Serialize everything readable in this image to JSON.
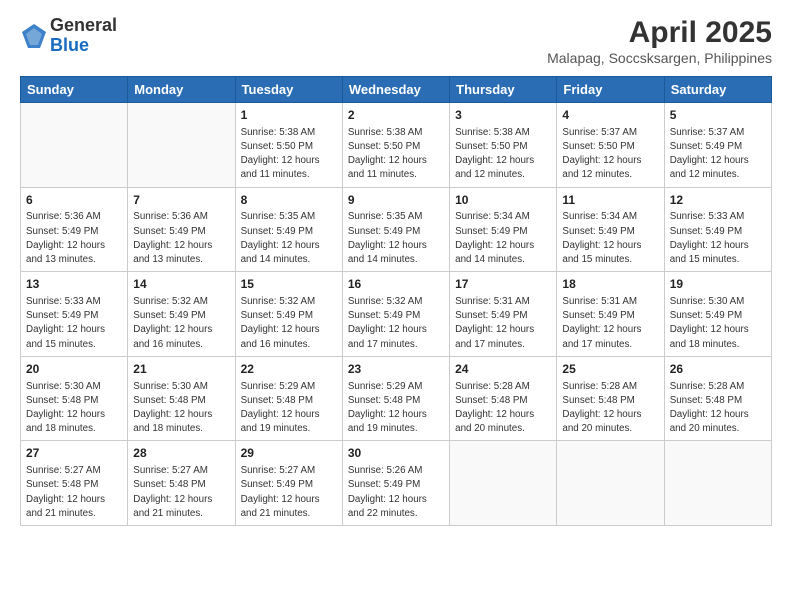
{
  "logo": {
    "general": "General",
    "blue": "Blue"
  },
  "title": {
    "month_year": "April 2025",
    "location": "Malapag, Soccsksargen, Philippines"
  },
  "weekdays": [
    "Sunday",
    "Monday",
    "Tuesday",
    "Wednesday",
    "Thursday",
    "Friday",
    "Saturday"
  ],
  "weeks": [
    [
      {
        "day": "",
        "info": ""
      },
      {
        "day": "",
        "info": ""
      },
      {
        "day": "1",
        "info": "Sunrise: 5:38 AM\nSunset: 5:50 PM\nDaylight: 12 hours and 11 minutes."
      },
      {
        "day": "2",
        "info": "Sunrise: 5:38 AM\nSunset: 5:50 PM\nDaylight: 12 hours and 11 minutes."
      },
      {
        "day": "3",
        "info": "Sunrise: 5:38 AM\nSunset: 5:50 PM\nDaylight: 12 hours and 12 minutes."
      },
      {
        "day": "4",
        "info": "Sunrise: 5:37 AM\nSunset: 5:50 PM\nDaylight: 12 hours and 12 minutes."
      },
      {
        "day": "5",
        "info": "Sunrise: 5:37 AM\nSunset: 5:49 PM\nDaylight: 12 hours and 12 minutes."
      }
    ],
    [
      {
        "day": "6",
        "info": "Sunrise: 5:36 AM\nSunset: 5:49 PM\nDaylight: 12 hours and 13 minutes."
      },
      {
        "day": "7",
        "info": "Sunrise: 5:36 AM\nSunset: 5:49 PM\nDaylight: 12 hours and 13 minutes."
      },
      {
        "day": "8",
        "info": "Sunrise: 5:35 AM\nSunset: 5:49 PM\nDaylight: 12 hours and 14 minutes."
      },
      {
        "day": "9",
        "info": "Sunrise: 5:35 AM\nSunset: 5:49 PM\nDaylight: 12 hours and 14 minutes."
      },
      {
        "day": "10",
        "info": "Sunrise: 5:34 AM\nSunset: 5:49 PM\nDaylight: 12 hours and 14 minutes."
      },
      {
        "day": "11",
        "info": "Sunrise: 5:34 AM\nSunset: 5:49 PM\nDaylight: 12 hours and 15 minutes."
      },
      {
        "day": "12",
        "info": "Sunrise: 5:33 AM\nSunset: 5:49 PM\nDaylight: 12 hours and 15 minutes."
      }
    ],
    [
      {
        "day": "13",
        "info": "Sunrise: 5:33 AM\nSunset: 5:49 PM\nDaylight: 12 hours and 15 minutes."
      },
      {
        "day": "14",
        "info": "Sunrise: 5:32 AM\nSunset: 5:49 PM\nDaylight: 12 hours and 16 minutes."
      },
      {
        "day": "15",
        "info": "Sunrise: 5:32 AM\nSunset: 5:49 PM\nDaylight: 12 hours and 16 minutes."
      },
      {
        "day": "16",
        "info": "Sunrise: 5:32 AM\nSunset: 5:49 PM\nDaylight: 12 hours and 17 minutes."
      },
      {
        "day": "17",
        "info": "Sunrise: 5:31 AM\nSunset: 5:49 PM\nDaylight: 12 hours and 17 minutes."
      },
      {
        "day": "18",
        "info": "Sunrise: 5:31 AM\nSunset: 5:49 PM\nDaylight: 12 hours and 17 minutes."
      },
      {
        "day": "19",
        "info": "Sunrise: 5:30 AM\nSunset: 5:49 PM\nDaylight: 12 hours and 18 minutes."
      }
    ],
    [
      {
        "day": "20",
        "info": "Sunrise: 5:30 AM\nSunset: 5:48 PM\nDaylight: 12 hours and 18 minutes."
      },
      {
        "day": "21",
        "info": "Sunrise: 5:30 AM\nSunset: 5:48 PM\nDaylight: 12 hours and 18 minutes."
      },
      {
        "day": "22",
        "info": "Sunrise: 5:29 AM\nSunset: 5:48 PM\nDaylight: 12 hours and 19 minutes."
      },
      {
        "day": "23",
        "info": "Sunrise: 5:29 AM\nSunset: 5:48 PM\nDaylight: 12 hours and 19 minutes."
      },
      {
        "day": "24",
        "info": "Sunrise: 5:28 AM\nSunset: 5:48 PM\nDaylight: 12 hours and 20 minutes."
      },
      {
        "day": "25",
        "info": "Sunrise: 5:28 AM\nSunset: 5:48 PM\nDaylight: 12 hours and 20 minutes."
      },
      {
        "day": "26",
        "info": "Sunrise: 5:28 AM\nSunset: 5:48 PM\nDaylight: 12 hours and 20 minutes."
      }
    ],
    [
      {
        "day": "27",
        "info": "Sunrise: 5:27 AM\nSunset: 5:48 PM\nDaylight: 12 hours and 21 minutes."
      },
      {
        "day": "28",
        "info": "Sunrise: 5:27 AM\nSunset: 5:48 PM\nDaylight: 12 hours and 21 minutes."
      },
      {
        "day": "29",
        "info": "Sunrise: 5:27 AM\nSunset: 5:49 PM\nDaylight: 12 hours and 21 minutes."
      },
      {
        "day": "30",
        "info": "Sunrise: 5:26 AM\nSunset: 5:49 PM\nDaylight: 12 hours and 22 minutes."
      },
      {
        "day": "",
        "info": ""
      },
      {
        "day": "",
        "info": ""
      },
      {
        "day": "",
        "info": ""
      }
    ]
  ]
}
